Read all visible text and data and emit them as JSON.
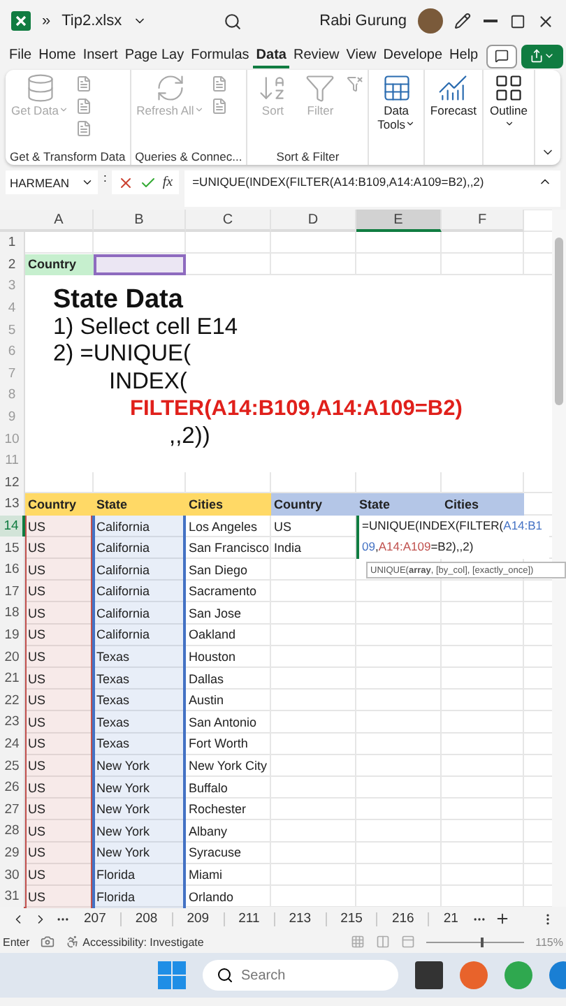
{
  "title_bar": {
    "overflow": "»",
    "file_name": "Tip2.xlsx",
    "user": "Rabi Gurung"
  },
  "menu_tabs": [
    {
      "label": "File",
      "selected": false
    },
    {
      "label": "Home",
      "selected": false
    },
    {
      "label": "Insert",
      "selected": false
    },
    {
      "label": "Page Lay",
      "selected": false
    },
    {
      "label": "Formulas",
      "selected": false
    },
    {
      "label": "Data",
      "selected": true
    },
    {
      "label": "Review",
      "selected": false
    },
    {
      "label": "View",
      "selected": false
    },
    {
      "label": "Develope",
      "selected": false
    },
    {
      "label": "Help",
      "selected": false
    }
  ],
  "ribbon": {
    "groups": [
      {
        "label": "Get & Transform Data",
        "buttons": [
          {
            "label": "Get Data",
            "kind": "database",
            "disabled": true,
            "dropdown": true
          }
        ]
      },
      {
        "label": "Queries & Connec...",
        "buttons": [
          {
            "label": "Refresh All",
            "kind": "refresh",
            "disabled": true,
            "dropdown": true
          }
        ]
      },
      {
        "label": "Sort & Filter",
        "buttons": [
          {
            "label": "Sort",
            "kind": "sort",
            "disabled": true,
            "dropdown": false
          },
          {
            "label": "Filter",
            "kind": "filter",
            "disabled": true,
            "dropdown": false
          }
        ]
      },
      {
        "buttons": [
          {
            "label": "Data Tools",
            "kind": "tools",
            "disabled": false,
            "dropdown": true
          }
        ]
      },
      {
        "buttons": [
          {
            "label": "Forecast",
            "kind": "forecast",
            "disabled": false,
            "dropdown": false
          }
        ]
      },
      {
        "buttons": [
          {
            "label": "Outline",
            "kind": "outline",
            "disabled": false,
            "dropdown": true
          }
        ]
      }
    ]
  },
  "formula_bar": {
    "name_box": "HARMEAN",
    "separator": ":",
    "function_label": "fx",
    "formula": "=UNIQUE(INDEX(FILTER(A14:B109,A14:A109=B2),,2)"
  },
  "columns": [
    {
      "label": "A",
      "selected": false
    },
    {
      "label": "B",
      "selected": false
    },
    {
      "label": "C",
      "selected": false
    },
    {
      "label": "D",
      "selected": false
    },
    {
      "label": "E",
      "selected": true
    },
    {
      "label": "F",
      "selected": false
    }
  ],
  "reference_ranges": [
    {
      "color": "#c0504d"
    },
    {
      "color": "#4472c4"
    }
  ],
  "rows": [
    {
      "number": "1",
      "kind": "blank",
      "selected": false,
      "cells": []
    },
    {
      "number": "2",
      "kind": "label",
      "selected": false,
      "cells": [
        {
          "text": "Country",
          "color": "#c6efce"
        },
        {
          "selected": true
        }
      ]
    },
    {
      "number": "3",
      "kind": "faint",
      "selected": false,
      "cells": []
    },
    {
      "number": "4",
      "kind": "faint",
      "selected": false,
      "cells": []
    },
    {
      "number": "5",
      "kind": "faint",
      "selected": false,
      "cells": []
    },
    {
      "number": "6",
      "kind": "faint",
      "selected": false,
      "cells": []
    },
    {
      "number": "7",
      "kind": "faint",
      "selected": false,
      "cells": []
    },
    {
      "number": "8",
      "kind": "faint",
      "selected": false,
      "cells": []
    },
    {
      "number": "9",
      "kind": "faint",
      "selected": false,
      "cells": []
    },
    {
      "number": "10",
      "kind": "faint",
      "selected": false,
      "cells": []
    },
    {
      "number": "11",
      "kind": "faint",
      "selected": false,
      "cells": []
    },
    {
      "number": "12",
      "kind": "blank",
      "selected": false,
      "cells": []
    },
    {
      "number": "13",
      "kind": "header",
      "selected": false,
      "cells": [
        {
          "text": "Country",
          "color": "#ffd966"
        },
        {
          "text": "State",
          "color": "#ffd966"
        },
        {
          "text": "Cities",
          "color": "#ffd966"
        },
        {
          "text": "Country",
          "color": "#b4c6e7"
        },
        {
          "text": "State",
          "color": "#b4c6e7"
        },
        {
          "text": "Cities",
          "color": "#b4c6e7"
        }
      ]
    },
    {
      "number": "14",
      "kind": "data",
      "selected": true,
      "cells": [
        {
          "text": "US"
        },
        {
          "text": "California"
        },
        {
          "text": "Los Angeles"
        },
        {
          "text": "US"
        }
      ]
    },
    {
      "number": "15",
      "kind": "data",
      "selected": false,
      "cells": [
        {
          "text": "US"
        },
        {
          "text": "California"
        },
        {
          "text": "San Francisco"
        },
        {
          "text": "India"
        }
      ]
    },
    {
      "number": "16",
      "kind": "data",
      "selected": false,
      "cells": [
        {
          "text": "US"
        },
        {
          "text": "California"
        },
        {
          "text": "San Diego"
        }
      ]
    },
    {
      "number": "17",
      "kind": "data",
      "selected": false,
      "cells": [
        {
          "text": "US"
        },
        {
          "text": "California"
        },
        {
          "text": "Sacramento"
        }
      ]
    },
    {
      "number": "18",
      "kind": "data",
      "selected": false,
      "cells": [
        {
          "text": "US"
        },
        {
          "text": "California"
        },
        {
          "text": "San Jose"
        }
      ]
    },
    {
      "number": "19",
      "kind": "data",
      "selected": false,
      "cells": [
        {
          "text": "US"
        },
        {
          "text": "California"
        },
        {
          "text": "Oakland"
        }
      ]
    },
    {
      "number": "20",
      "kind": "data",
      "selected": false,
      "cells": [
        {
          "text": "US"
        },
        {
          "text": "Texas"
        },
        {
          "text": "Houston"
        }
      ]
    },
    {
      "number": "21",
      "kind": "data",
      "selected": false,
      "cells": [
        {
          "text": "US"
        },
        {
          "text": "Texas"
        },
        {
          "text": "Dallas"
        }
      ]
    },
    {
      "number": "22",
      "kind": "data",
      "selected": false,
      "cells": [
        {
          "text": "US"
        },
        {
          "text": "Texas"
        },
        {
          "text": "Austin"
        }
      ]
    },
    {
      "number": "23",
      "kind": "data",
      "selected": false,
      "cells": [
        {
          "text": "US"
        },
        {
          "text": "Texas"
        },
        {
          "text": "San Antonio"
        }
      ]
    },
    {
      "number": "24",
      "kind": "data",
      "selected": false,
      "cells": [
        {
          "text": "US"
        },
        {
          "text": "Texas"
        },
        {
          "text": "Fort Worth"
        }
      ]
    },
    {
      "number": "25",
      "kind": "data",
      "selected": false,
      "cells": [
        {
          "text": "US"
        },
        {
          "text": "New York"
        },
        {
          "text": "New York City"
        }
      ]
    },
    {
      "number": "26",
      "kind": "data",
      "selected": false,
      "cells": [
        {
          "text": "US"
        },
        {
          "text": "New York"
        },
        {
          "text": "Buffalo"
        }
      ]
    },
    {
      "number": "27",
      "kind": "data",
      "selected": false,
      "cells": [
        {
          "text": "US"
        },
        {
          "text": "New York"
        },
        {
          "text": "Rochester"
        }
      ]
    },
    {
      "number": "28",
      "kind": "data",
      "selected": false,
      "cells": [
        {
          "text": "US"
        },
        {
          "text": "New York"
        },
        {
          "text": "Albany"
        }
      ]
    },
    {
      "number": "29",
      "kind": "data",
      "selected": false,
      "cells": [
        {
          "text": "US"
        },
        {
          "text": "New York"
        },
        {
          "text": "Syracuse"
        }
      ]
    },
    {
      "number": "30",
      "kind": "data",
      "selected": false,
      "cells": [
        {
          "text": "US"
        },
        {
          "text": "Florida"
        },
        {
          "text": "Miami"
        }
      ]
    },
    {
      "number": "31",
      "kind": "data",
      "selected": false,
      "cells": [
        {
          "text": "US"
        },
        {
          "text": "Florida"
        },
        {
          "text": "Orlando"
        }
      ]
    }
  ],
  "overlay": {
    "lines": [
      {
        "text": "State Data",
        "kind": "title"
      },
      {
        "text": "1) Sellect cell E14",
        "kind": "step"
      },
      {
        "text": "2) =UNIQUE(",
        "kind": "step"
      },
      {
        "text": "INDEX(",
        "kind": "sub"
      },
      {
        "text": "FILTER(A14:B109,A14:A109=B2)",
        "kind": "highlight"
      },
      {
        "text": ",,2))",
        "kind": "tail"
      }
    ]
  },
  "cell_editor": {
    "segments": [
      {
        "text": "=UNIQUE(INDEX(FILTER("
      },
      {
        "text": "A14:B109",
        "color": "#4472c4"
      },
      {
        "text": ","
      },
      {
        "text": "A14:A109",
        "color": "#c0504d"
      },
      {
        "text": "=B2),,2)"
      }
    ],
    "tooltip": "UNIQUE(**array**, [by_col], [exactly_once])"
  },
  "sheet_tabs": [
    {
      "label": "207"
    },
    {
      "label": "208"
    },
    {
      "label": "209"
    },
    {
      "label": "211"
    },
    {
      "label": "213"
    },
    {
      "label": "215"
    },
    {
      "label": "216"
    },
    {
      "label": "21"
    }
  ],
  "status_bar": {
    "mode": "Enter",
    "accessibility": "Accessibility: Investigate",
    "zoom": {
      "reading": "115%",
      "level": 0.55
    }
  },
  "taskbar": {
    "search": {
      "placeholder": "Search"
    }
  }
}
